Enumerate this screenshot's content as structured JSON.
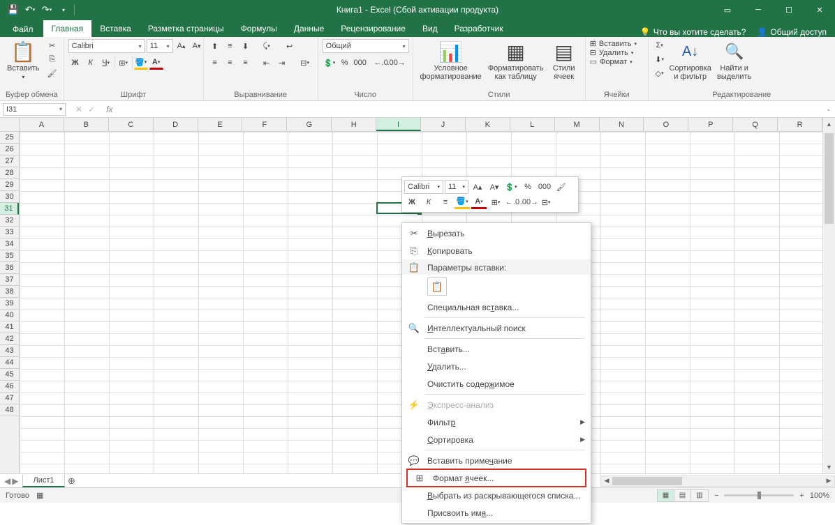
{
  "title": "Книга1 - Excel (Сбой активации продукта)",
  "qat": {
    "save": "💾",
    "undo": "↶",
    "redo": "↷"
  },
  "tabs": {
    "file": "Файл",
    "items": [
      "Главная",
      "Вставка",
      "Разметка страницы",
      "Формулы",
      "Данные",
      "Рецензирование",
      "Вид",
      "Разработчик"
    ],
    "active": 0,
    "tell_me": "Что вы хотите сделать?",
    "share": "Общий доступ"
  },
  "ribbon": {
    "clipboard": {
      "paste": "Вставить",
      "label": "Буфер обмена"
    },
    "font": {
      "name": "Calibri",
      "size": "11",
      "label": "Шрифт",
      "bold": "Ж",
      "italic": "К",
      "underline": "Ч"
    },
    "alignment": {
      "label": "Выравнивание"
    },
    "number": {
      "format": "Общий",
      "label": "Число"
    },
    "styles": {
      "cond": "Условное форматирование",
      "table": "Форматировать как таблицу",
      "cell": "Стили ячеек",
      "label": "Стили"
    },
    "cells": {
      "insert": "Вставить",
      "delete": "Удалить",
      "format": "Формат",
      "label": "Ячейки"
    },
    "editing": {
      "sort": "Сортировка и фильтр",
      "find": "Найти и выделить",
      "label": "Редактирование"
    }
  },
  "formula_bar": {
    "name_box": "I31",
    "fx": "fx"
  },
  "columns": [
    "A",
    "B",
    "C",
    "D",
    "E",
    "F",
    "G",
    "H",
    "I",
    "J",
    "K",
    "L",
    "M",
    "N",
    "O",
    "P",
    "Q",
    "R"
  ],
  "selected_col": "I",
  "rows_start": 25,
  "rows_end": 48,
  "selected_row": 31,
  "mini_toolbar": {
    "font": "Calibri",
    "size": "11",
    "bold": "Ж",
    "italic": "К"
  },
  "context_menu": {
    "cut": "Вырезать",
    "copy": "Копировать",
    "paste_options": "Параметры вставки:",
    "paste_special": "Специальная вставка...",
    "smart_lookup": "Интеллектуальный поиск",
    "insert": "Вставить...",
    "delete": "Удалить...",
    "clear": "Очистить содержимое",
    "quick_analysis": "Экспресс-анализ",
    "filter": "Фильтр",
    "sort": "Сортировка",
    "comment": "Вставить примечание",
    "format_cells": "Формат ячеек...",
    "dropdown": "Выбрать из раскрывающегося списка...",
    "define_name": "Присвоить имя..."
  },
  "sheet": {
    "name": "Лист1"
  },
  "status": {
    "ready": "Готово",
    "zoom": "100%"
  }
}
